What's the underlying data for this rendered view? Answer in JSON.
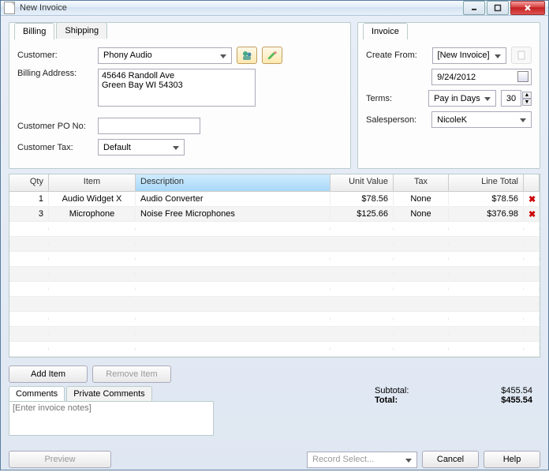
{
  "window": {
    "title": "New Invoice"
  },
  "billing": {
    "tabs": [
      "Billing",
      "Shipping"
    ],
    "customer_label": "Customer:",
    "customer_value": "Phony Audio",
    "address_label": "Billing Address:",
    "address_value": "45646 Randoll Ave\nGreen Bay WI 54303",
    "po_label": "Customer PO No:",
    "po_value": "",
    "tax_label": "Customer Tax:",
    "tax_value": "Default"
  },
  "invoice": {
    "tab": "Invoice",
    "create_from_label": "Create From:",
    "create_from_value": "[New Invoice]",
    "date_value": "9/24/2012",
    "terms_label": "Terms:",
    "terms_value": "Pay in Days",
    "terms_days": "30",
    "salesperson_label": "Salesperson:",
    "salesperson_value": "NicoleK"
  },
  "grid": {
    "headers": {
      "qty": "Qty",
      "item": "Item",
      "desc": "Description",
      "unit_value": "Unit Value",
      "tax": "Tax",
      "line_total": "Line Total"
    },
    "rows": [
      {
        "qty": "1",
        "item": "Audio Widget X",
        "desc": "Audio Converter",
        "unit_value": "$78.56",
        "tax": "None",
        "line_total": "$78.56"
      },
      {
        "qty": "3",
        "item": "Microphone",
        "desc": "Noise Free Microphones",
        "unit_value": "$125.66",
        "tax": "None",
        "line_total": "$376.98"
      }
    ]
  },
  "buttons": {
    "add_item": "Add Item",
    "remove_item": "Remove Item",
    "preview": "Preview",
    "record": "Record Select...",
    "cancel": "Cancel",
    "help": "Help"
  },
  "comments": {
    "tabs": [
      "Comments",
      "Private Comments"
    ],
    "placeholder": "[Enter invoice notes]"
  },
  "totals": {
    "subtotal_label": "Subtotal:",
    "subtotal_value": "$455.54",
    "total_label": "Total:",
    "total_value": "$455.54"
  }
}
